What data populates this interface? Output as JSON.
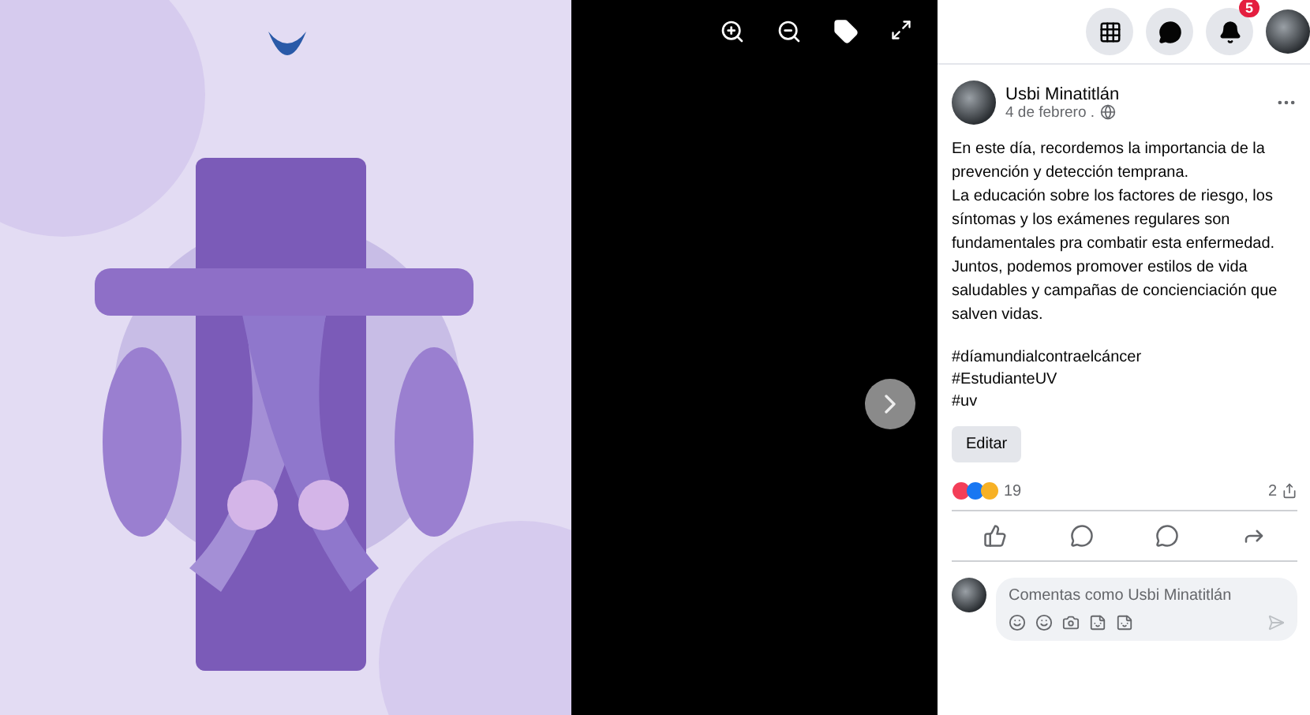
{
  "topbar": {
    "notifications_badge": "5"
  },
  "post": {
    "author": "Usbi Minatitlán",
    "date": "4 de febrero .",
    "body": [
      "En este día, recordemos la importancia de la prevención y detección temprana.",
      "La educación sobre los factores de riesgo, los síntomas y los exámenes regulares son fundamentales pra combatir esta enfermedad. Juntos, podemos promover estilos de vida saludables y campañas de concienciación que salven vidas."
    ],
    "hashtags": [
      "#díamundialcontraelcáncer",
      "#EstudianteUV",
      "#uv"
    ],
    "edit_button": "Editar",
    "reactions_count": "19",
    "shares_count": "2",
    "comment_placeholder": "Comentas como Usbi Minatitlán"
  }
}
